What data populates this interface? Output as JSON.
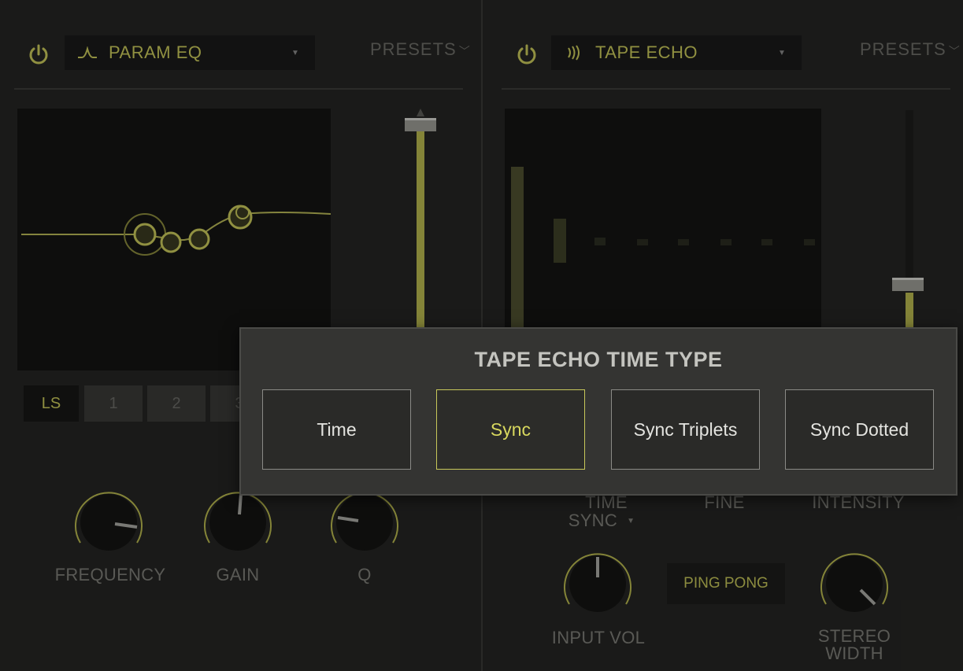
{
  "colors": {
    "accent": "#c8c85a",
    "panel": "#252523",
    "dialog": "#343432"
  },
  "left_slot": {
    "power_icon": "power-icon",
    "effect_icon": "eq-curve-icon",
    "effect_name": "PARAM EQ",
    "presets_label": "PRESETS",
    "bands": [
      "LS",
      "1",
      "2",
      "3"
    ],
    "selected_band": "LS",
    "knobs": [
      {
        "label": "FREQUENCY"
      },
      {
        "label": "GAIN"
      },
      {
        "label": "Q"
      }
    ]
  },
  "right_slot": {
    "power_icon": "power-icon",
    "effect_icon": "echo-waves-icon",
    "effect_name": "TAPE ECHO",
    "presets_label": "PRESETS",
    "param_labels": {
      "time": "TIME",
      "time_sync": "SYNC",
      "fine": "FINE",
      "intensity": "INTENSITY"
    },
    "knobs": [
      {
        "label": "INPUT VOL"
      },
      {
        "label": "STEREO WIDTH"
      }
    ],
    "ping_pong_label": "PING PONG"
  },
  "dialog": {
    "title": "TAPE ECHO TIME TYPE",
    "options": [
      "Time",
      "Sync",
      "Sync Triplets",
      "Sync Dotted"
    ],
    "selected": "Sync"
  }
}
